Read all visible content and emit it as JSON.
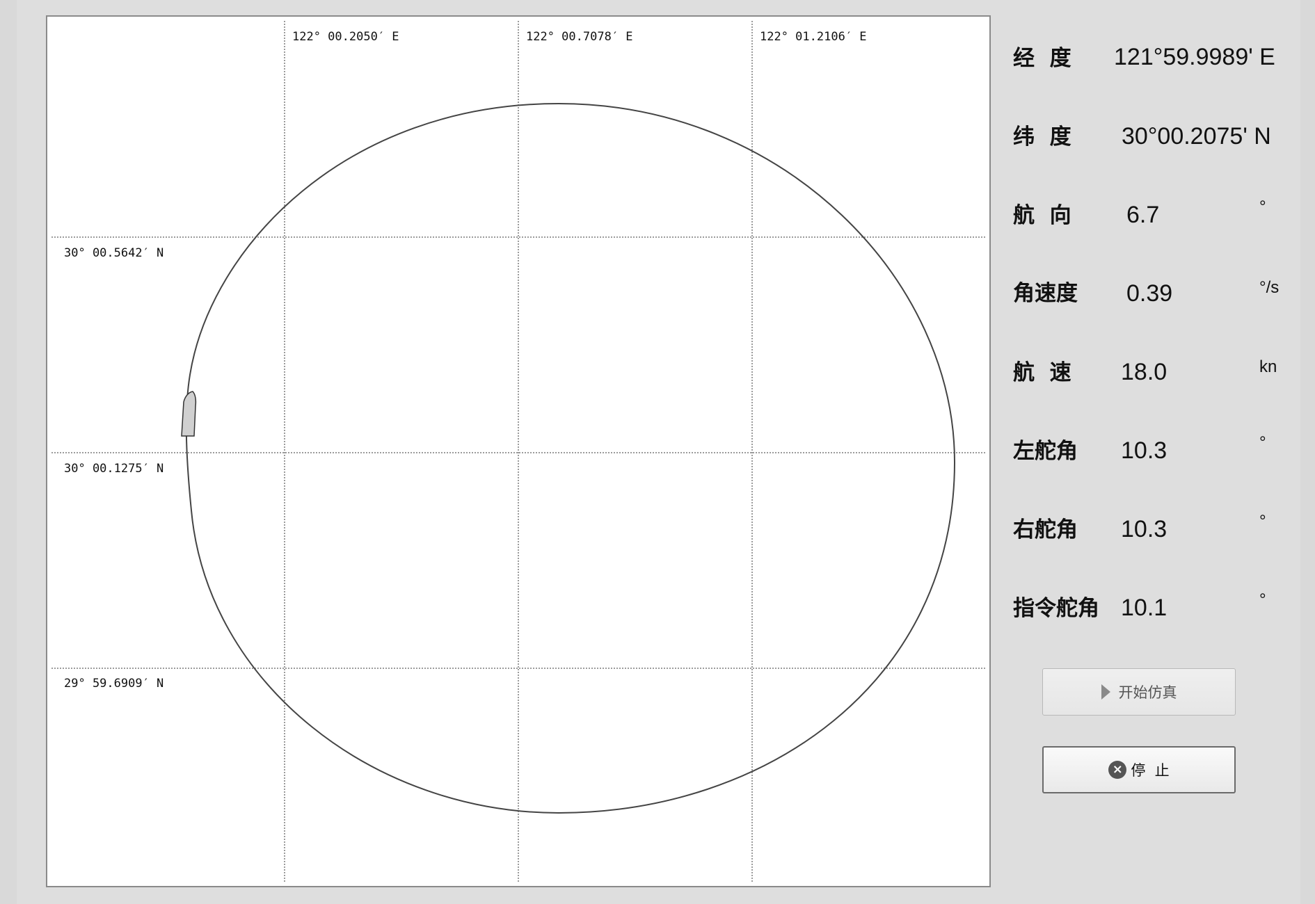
{
  "chart": {
    "lon_labels": [
      "122° 00.2050′ E",
      "122° 00.7078′ E",
      "122° 01.2106′ E"
    ],
    "lat_labels": [
      "30° 00.5642′ N",
      "30° 00.1275′ N",
      "29° 59.6909′ N"
    ]
  },
  "info": {
    "longitude": {
      "label": "经  度",
      "value": "121°59.9989' E"
    },
    "latitude": {
      "label": "纬  度",
      "value": "30°00.2075' N"
    },
    "heading": {
      "label": "航  向",
      "value": "6.7",
      "unit": "°"
    },
    "angular_speed": {
      "label": "角速度",
      "value": "0.39",
      "unit": "°/s"
    },
    "speed": {
      "label": "航  速",
      "value": "18.0",
      "unit": "kn"
    },
    "left_rudder": {
      "label": "左舵角",
      "value": "10.3",
      "unit": "°"
    },
    "right_rudder": {
      "label": "右舵角",
      "value": "10.3",
      "unit": "°"
    },
    "command_rudder": {
      "label": "指令舵角",
      "value": "10.1",
      "unit": "°"
    }
  },
  "buttons": {
    "start_label": "开始仿真",
    "stop_label": "停  止"
  },
  "icons": {
    "start": "play-icon",
    "stop": "stop-circle-icon"
  }
}
